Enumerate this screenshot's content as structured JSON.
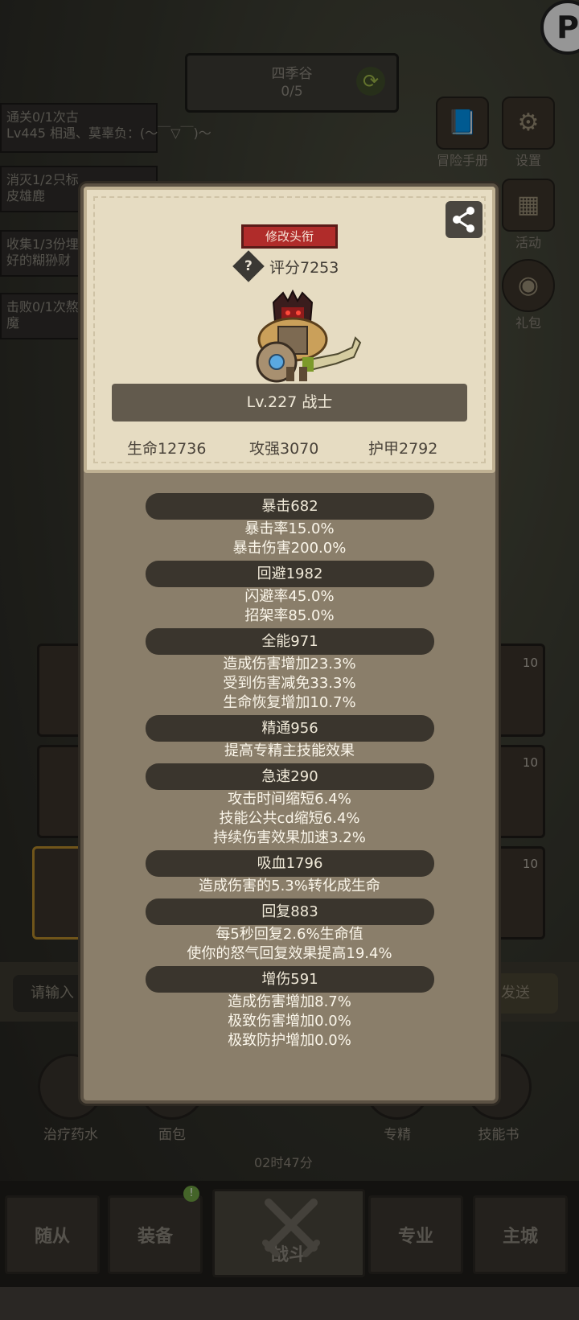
{
  "background": {
    "location": {
      "name": "四季谷",
      "progress": "0/5"
    },
    "quests": [
      {
        "line1": "通关0/1次古",
        "line2": "Lv445 相遇、莫辜负：(～￣▽￣)～"
      },
      {
        "line1": "消灭1/2只标",
        "line2": "皮雄鹿"
      },
      {
        "line1": "收集1/3份埋",
        "line2": "好的糊狲财"
      },
      {
        "line1": "击败0/1次熬",
        "line2": "魔"
      }
    ],
    "side_menu": [
      {
        "label": "冒险手册",
        "icon": "book-icon"
      },
      {
        "label": "设置",
        "icon": "gear-icon"
      },
      {
        "label": "活动",
        "icon": "calendar-icon"
      },
      {
        "label": "礼包",
        "icon": "gift-icon"
      }
    ],
    "slot_counts": [
      "10",
      "10",
      "10"
    ],
    "chat": {
      "placeholder": "请输入",
      "send_label": "发送"
    },
    "items": [
      {
        "label": "治疗药水",
        "icon": "potion-icon"
      },
      {
        "label": "面包",
        "icon": "bread-icon"
      },
      {
        "label": "专精",
        "icon": "target-icon"
      },
      {
        "label": "技能书",
        "icon": "book-icon"
      }
    ],
    "timer": "02时47分",
    "nav": [
      {
        "label": "随从"
      },
      {
        "label": "装备",
        "badge": "!"
      },
      {
        "label": "战斗"
      },
      {
        "label": "专业"
      },
      {
        "label": "主城"
      }
    ]
  },
  "modal": {
    "title_button": "修改头衔",
    "score_label": "评分7253",
    "level_class": "Lv.227 战士",
    "stats": {
      "hp": "生命12736",
      "attack": "攻强3070",
      "armor": "护甲2792"
    },
    "sections": [
      {
        "header": "暴击682",
        "lines": [
          "暴击率15.0%",
          "暴击伤害200.0%"
        ]
      },
      {
        "header": "回避1982",
        "lines": [
          "闪避率45.0%",
          "招架率85.0%"
        ]
      },
      {
        "header": "全能971",
        "lines": [
          "造成伤害增加23.3%",
          "受到伤害减免33.3%",
          "生命恢复增加10.7%"
        ]
      },
      {
        "header": "精通956",
        "lines": [
          "提高专精主技能效果"
        ]
      },
      {
        "header": "急速290",
        "lines": [
          "攻击时间缩短6.4%",
          "技能公共cd缩短6.4%",
          "持续伤害效果加速3.2%"
        ]
      },
      {
        "header": "吸血1796",
        "lines": [
          "造成伤害的5.3%转化成生命"
        ]
      },
      {
        "header": "回复883",
        "lines": [
          "每5秒回复2.6%生命值",
          "使你的怒气回复效果提高19.4%"
        ]
      },
      {
        "header": "增伤591",
        "lines": [
          "造成伤害增加8.7%",
          "极致伤害增加0.0%",
          "极致防护增加0.0%"
        ]
      }
    ]
  }
}
